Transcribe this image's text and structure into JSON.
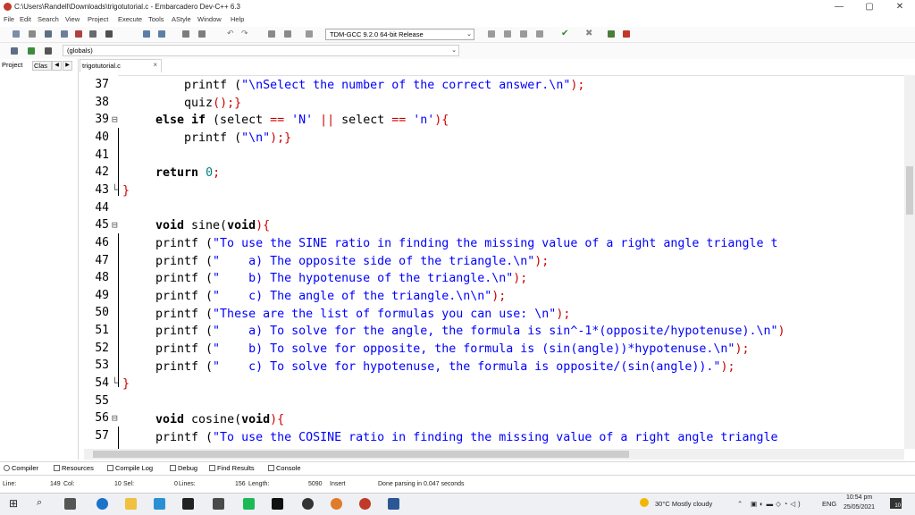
{
  "window": {
    "title": "C:\\Users\\Randell\\Downloads\\trigotutorial.c - Embarcadero Dev-C++ 6.3",
    "minimize": "—",
    "maximize": "▢",
    "close": "✕"
  },
  "menu": [
    "File",
    "Edit",
    "Search",
    "View",
    "Project",
    "Execute",
    "Tools",
    "AStyle",
    "Window",
    "Help"
  ],
  "toolbar": {
    "compiler": "TDM-GCC 9.2.0 64-bit Release"
  },
  "scope": {
    "value": "(globals)"
  },
  "left_panel": {
    "tab_project": "Project",
    "tab_classes": "Clas"
  },
  "editor": {
    "file_tab": "trigotutorial.c",
    "lines": [
      {
        "n": "37",
        "fold": ""
      },
      {
        "n": "38",
        "fold": ""
      },
      {
        "n": "39",
        "fold": "⊟"
      },
      {
        "n": "40",
        "fold": ""
      },
      {
        "n": "41",
        "fold": ""
      },
      {
        "n": "42",
        "fold": ""
      },
      {
        "n": "43",
        "fold": "└"
      },
      {
        "n": "44",
        "fold": ""
      },
      {
        "n": "45",
        "fold": "⊟"
      },
      {
        "n": "46",
        "fold": ""
      },
      {
        "n": "47",
        "fold": ""
      },
      {
        "n": "48",
        "fold": ""
      },
      {
        "n": "49",
        "fold": ""
      },
      {
        "n": "50",
        "fold": ""
      },
      {
        "n": "51",
        "fold": ""
      },
      {
        "n": "52",
        "fold": ""
      },
      {
        "n": "53",
        "fold": ""
      },
      {
        "n": "54",
        "fold": "└"
      },
      {
        "n": "55",
        "fold": ""
      },
      {
        "n": "56",
        "fold": "⊟"
      },
      {
        "n": "57",
        "fold": ""
      }
    ],
    "code": {
      "l37_a": "printf (",
      "l37_s": "\"\\nSelect the number of the correct answer.\\n\"",
      "l37_b": ");",
      "l38_a": "quiz",
      "l38_b": "();}",
      "l39_kw1": "else if",
      "l39_a": " (select ",
      "l39_op": "==",
      "l39_s1": " 'N' ",
      "l39_or": "||",
      "l39_b": " select ",
      "l39_op2": "==",
      "l39_s2": " 'n'",
      "l39_c": "){",
      "l40_a": "printf (",
      "l40_s": "\"\\n\"",
      "l40_b": ");}",
      "l42_kw": "return",
      "l42_num": "0",
      "l42_b": ";",
      "l43": "}",
      "l45_kw": "void",
      "l45_a": " sine(",
      "l45_kw2": "void",
      "l45_b": "){",
      "l46_a": "printf (",
      "l46_s": "\"To use the SINE ratio in finding the missing value of a right angle triangle t",
      "l47_a": "printf (",
      "l47_s": "\"    a) The opposite side of the triangle.\\n\"",
      "l47_b": ");",
      "l48_a": "printf (",
      "l48_s": "\"    b) The hypotenuse of the triangle.\\n\"",
      "l48_b": ");",
      "l49_a": "printf (",
      "l49_s": "\"    c) The angle of the triangle.\\n\\n\"",
      "l49_b": ");",
      "l50_a": "printf (",
      "l50_s": "\"These are the list of formulas you can use: \\n\"",
      "l50_b": ");",
      "l51_a": "printf (",
      "l51_s": "\"    a) To solve for the angle, the formula is sin^-1*(opposite/hypotenuse).\\n\"",
      "l51_b": ")",
      "l52_a": "printf (",
      "l52_s": "\"    b) To solve for opposite, the formula is (sin(angle))*hypotenuse.\\n\"",
      "l52_b": ");",
      "l53_a": "printf (",
      "l53_s": "\"    c) To solve for hypotenuse, the formula is opposite/(sin(angle)).\"",
      "l53_b": ");",
      "l54": "}",
      "l56_kw": "void",
      "l56_a": " cosine(",
      "l56_kw2": "void",
      "l56_b": "){",
      "l57_a": "printf (",
      "l57_s": "\"To use the COSINE ratio in finding the missing value of a right angle triangle"
    }
  },
  "bottom_tabs": [
    "Compiler",
    "Resources",
    "Compile Log",
    "Debug",
    "Find Results",
    "Console"
  ],
  "status": {
    "line_label": "Line:",
    "line_val": "149",
    "col_label": "Col:",
    "col_val": "10",
    "sel_label": "Sel:",
    "sel_val": "0",
    "lines_label": "Lines:",
    "lines_val": "156",
    "length_label": "Length:",
    "length_val": "5090",
    "mode": "Insert",
    "message": "Done parsing in 0.047 seconds"
  },
  "taskbar": {
    "weather": "30°C  Mostly cloudy",
    "lang": "ENG",
    "time": "10:54 pm",
    "date": "25/05/2021",
    "notif": "10"
  }
}
